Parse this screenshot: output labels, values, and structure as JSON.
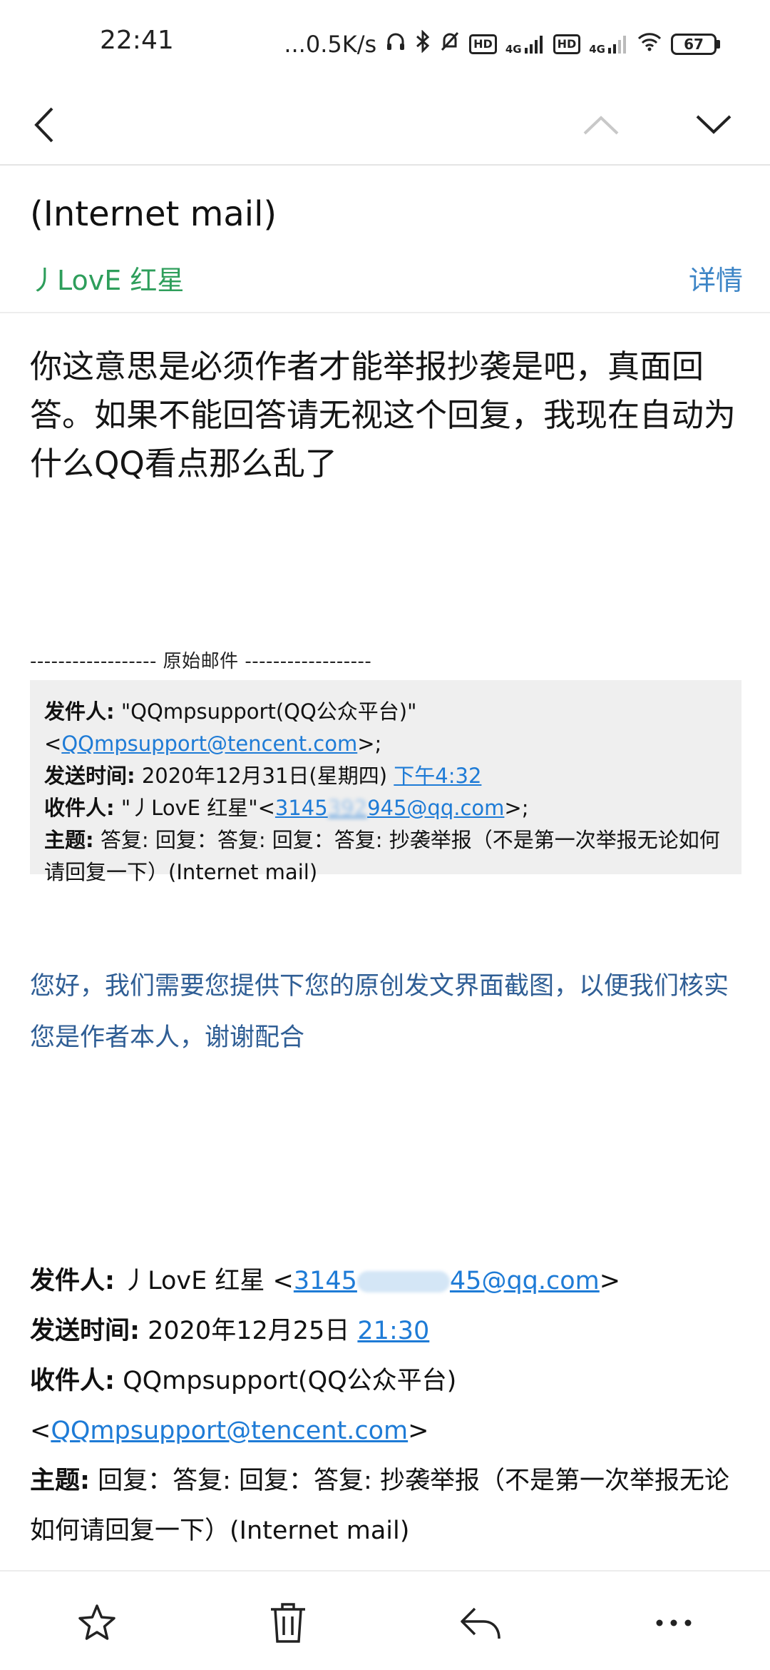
{
  "status_bar": {
    "time": "22:41",
    "net_speed": "...0.5K/s",
    "hd1": "HD",
    "net1": "4G",
    "hd2": "HD",
    "net2": "4G",
    "battery": "67"
  },
  "nav": {
    "back_icon": "chevron-left-icon",
    "prev_icon": "chevron-up-icon",
    "next_icon": "chevron-down-icon"
  },
  "header": {
    "subject_partial": "报（不是第一次举报无论如何请回复一下）",
    "subject_tail": "(Internet mail)",
    "sender": "丿LovE 红星",
    "details_label": "详情"
  },
  "message": {
    "body": "你这意思是必须作者才能举报抄袭是吧，真面回答。如果不能回答请无视这个回复，我现在自动为什么QQ看点那么乱了"
  },
  "original": {
    "separator": "------------------ 原始邮件 ------------------",
    "from_label": "发件人:",
    "from_name": "\"QQmpsupport(QQ公众平台)\" <",
    "from_email": "QQmpsupport@tencent.com",
    "from_end": ">;",
    "time_label": "发送时间:",
    "time_date": "2020年12月31日(星期四) ",
    "time_link": "下午4:32",
    "to_label": "收件人:",
    "to_name": "\"丿LovE 红星\"<",
    "to_email_a": "3145",
    "to_email_blur": "392",
    "to_email_b": "945@qq.com",
    "to_end": ">;",
    "subject_label": "主题:",
    "subject": "答复: 回复：答复: 回复：答复: 抄袭举报（不是第一次举报无论如何请回复一下）(Internet mail)"
  },
  "reply": {
    "text": "您好，我们需要您提供下您的原创发文界面截图，以便我们核实您是作者本人，谢谢配合"
  },
  "quoted": {
    "from_label": "发件人:",
    "from_name": " 丿LovE 红星 <",
    "from_email_a": "3145",
    "from_email_b": "45@qq.com",
    "from_end": ">",
    "time_label": "发送时间:",
    "time_date": " 2020年12月25日 ",
    "time_link": "21:30",
    "to_label": "收件人:",
    "to_name": " QQmpsupport(QQ公众平台)",
    "to_open": "<",
    "to_email": "QQmpsupport@tencent.com",
    "to_end": ">",
    "subject_label": "主题:",
    "subject": " 回复：答复: 回复：答复: 抄袭举报（不是第一次举报无论如何请回复一下）(Internet mail)"
  },
  "toolbar": {
    "star_icon": "star-icon",
    "delete_icon": "trash-icon",
    "reply_icon": "reply-icon",
    "more_icon": "more-icon"
  },
  "colors": {
    "sender_green": "#2e9e5b",
    "link_blue": "#1e7bd6",
    "reply_text_blue": "#2f5e95",
    "details_blue": "#3d85c6",
    "quote_bg": "#efefef"
  }
}
